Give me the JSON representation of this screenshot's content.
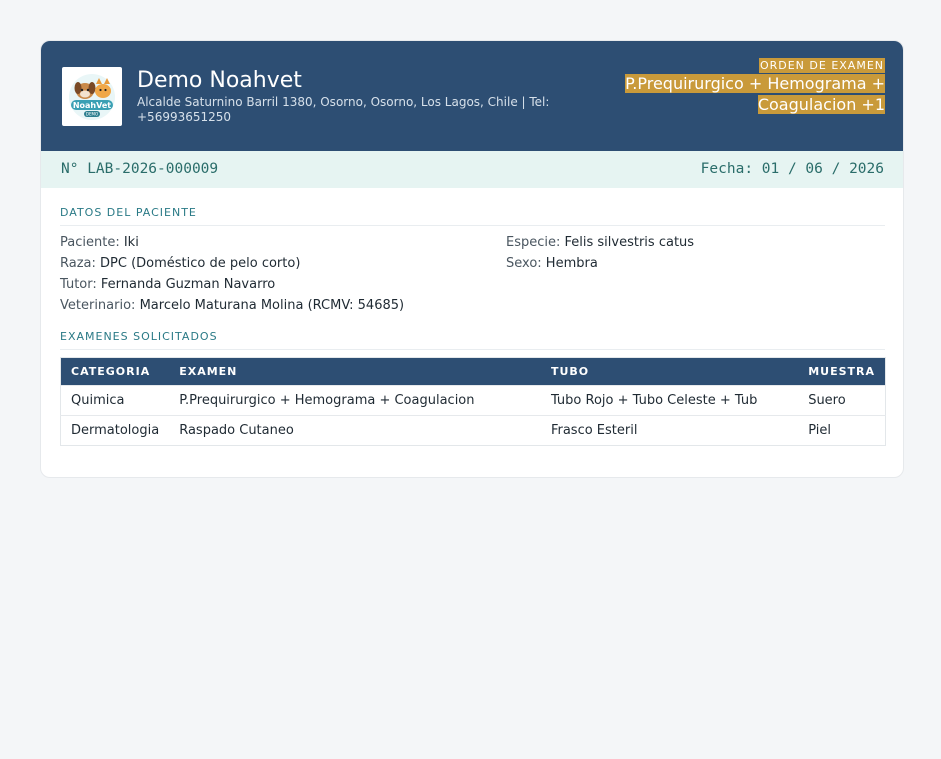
{
  "header": {
    "clinic_name": "Demo Noahvet",
    "clinic_address": "Alcalde Saturnino Barril 1380, Osorno, Osorno, Los Lagos, Chile | Tel: +56993651250",
    "logo_text": "NoahVet",
    "logo_subtext": "DEMO",
    "order_label": "ORDEN DE EXAMEN",
    "order_title": "P.Prequirurgico + Hemograma + Coagulacion +1"
  },
  "numbar": {
    "number": "N° LAB-2026-000009",
    "date": "Fecha: 01 / 06 / 2026"
  },
  "patient": {
    "section_title": "DATOS DEL PACIENTE",
    "paciente_label": "Paciente:",
    "paciente_value": "Iki",
    "especie_label": "Especie:",
    "especie_value": "Felis silvestris catus",
    "raza_label": "Raza:",
    "raza_value": "DPC (Doméstico de pelo corto)",
    "sexo_label": "Sexo:",
    "sexo_value": "Hembra",
    "tutor_label": "Tutor:",
    "tutor_value": "Fernanda Guzman Navarro",
    "vet_label": "Veterinario:",
    "vet_value": "Marcelo Maturana Molina (RCMV: 54685)"
  },
  "exams": {
    "section_title": "EXAMENES SOLICITADOS",
    "headers": [
      "CATEGORIA",
      "EXAMEN",
      "TUBO",
      "MUESTRA"
    ],
    "rows": [
      [
        "Quimica",
        "P.Prequirurgico + Hemograma + Coagulacion",
        "Tubo Rojo + Tubo Celeste + Tub",
        "Suero"
      ],
      [
        "Dermatologia",
        "Raspado Cutaneo",
        "Frasco Esteril",
        "Piel"
      ]
    ]
  },
  "colors": {
    "header_bg": "#2d4e73",
    "accent_gold": "#c99a3a",
    "numbar_bg": "#e6f4f2",
    "teal_text": "#2a7a86"
  }
}
